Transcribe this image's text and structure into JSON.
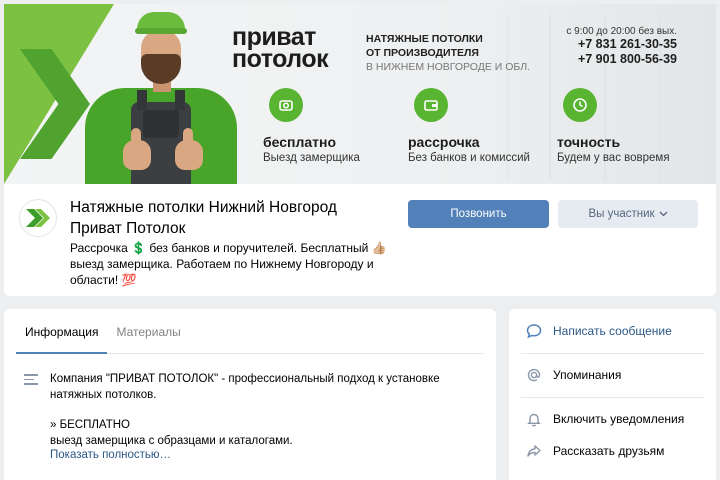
{
  "cover": {
    "brand_line1": "приват",
    "brand_line2": "потолок",
    "tagline_line1": "НАТЯЖНЫЕ ПОТОЛКИ",
    "tagline_line2": "ОТ ПРОИЗВОДИТЕЛЯ",
    "tagline_line3": "В НИЖНЕМ НОВГОРОДЕ И ОБЛ.",
    "hours": "с 9:00 до 20:00 без вых.",
    "phone1": "+7 831 261-30-35",
    "phone2": "+7 901 800-56-39",
    "features": [
      {
        "title": "бесплатно",
        "subtitle": "Выезд замерщика",
        "icon": "measure-icon"
      },
      {
        "title": "рассрочка",
        "subtitle": "Без банков и комиссий",
        "icon": "wallet-icon"
      },
      {
        "title": "точность",
        "subtitle": "Будем у вас вовремя",
        "icon": "clock-icon"
      }
    ],
    "accent_color": "#58b431"
  },
  "profile": {
    "title": "Натяжные потолки Нижний Новгород Приват Потолок",
    "status": "Рассрочка 💲 без банков и поручителей. Бесплатный 👍🏼 выезд замерщика. Работаем по Нижнему Новгороду и области! 💯",
    "call_button": "Позвонить",
    "member_button": "Вы участник"
  },
  "info": {
    "tabs": [
      {
        "label": "Информация",
        "active": true
      },
      {
        "label": "Материалы",
        "active": false
      }
    ],
    "paragraph1": "Компания \"ПРИВАТ ПОТОЛОК\" - профессиональный подход к установке натяжных потолков.",
    "paragraph2_line1": "» БЕСПЛАТНО",
    "paragraph2_line2": "выезд замерщика с образцами и каталогами.",
    "show_more": "Показать полностью…"
  },
  "actions": [
    {
      "label": "Написать сообщение",
      "icon": "message-icon",
      "primary": true
    },
    {
      "label": "Упоминания",
      "icon": "at-icon",
      "primary": false
    },
    {
      "label": "Включить уведомления",
      "icon": "bell-icon",
      "primary": false
    },
    {
      "label": "Рассказать друзьям",
      "icon": "share-icon",
      "primary": false
    }
  ]
}
